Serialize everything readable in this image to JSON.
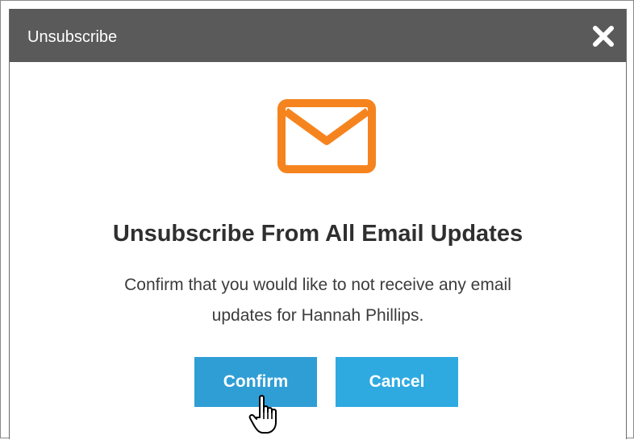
{
  "dialog": {
    "title": "Unsubscribe",
    "close_icon": "close-icon",
    "mail_icon": "envelope-icon",
    "accent_color": "#f5841f",
    "heading": "Unsubscribe From All Email Updates",
    "message_line1": "Confirm that you would like to not receive any email",
    "message_line2": "updates for Hannah Phillips.",
    "confirm_label": "Confirm",
    "cancel_label": "Cancel",
    "button_color": "#2eaae1",
    "pointer_icon": "hand-pointer-icon"
  }
}
